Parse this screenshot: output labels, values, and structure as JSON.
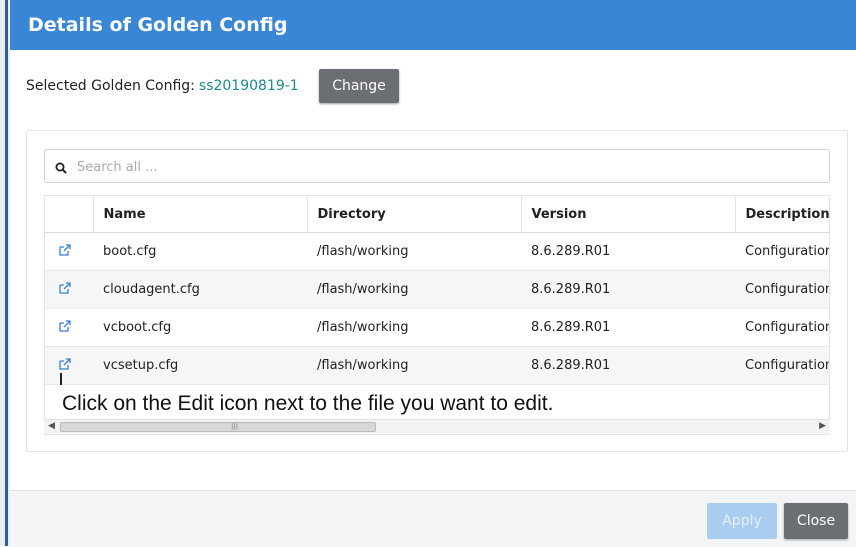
{
  "dialog": {
    "title": "Details of Golden Config",
    "selected_label": "Selected Golden Config:",
    "selected_value": "ss20190819-1",
    "change_label": "Change"
  },
  "search": {
    "placeholder": "Search all ..."
  },
  "table": {
    "columns": [
      "",
      "Name",
      "Directory",
      "Version",
      "Description"
    ],
    "rows": [
      {
        "name": "boot.cfg",
        "directory": "/flash/working",
        "version": "8.6.289.R01",
        "description": "Configuration"
      },
      {
        "name": "cloudagent.cfg",
        "directory": "/flash/working",
        "version": "8.6.289.R01",
        "description": "Configuration"
      },
      {
        "name": "vcboot.cfg",
        "directory": "/flash/working",
        "version": "8.6.289.R01",
        "description": "Configuration"
      },
      {
        "name": "vcsetup.cfg",
        "directory": "/flash/working",
        "version": "8.6.289.R01",
        "description": "Configuration"
      }
    ]
  },
  "caption": "Click on the Edit icon next to the file you want to edit.",
  "footer": {
    "apply_label": "Apply",
    "close_label": "Close"
  },
  "colors": {
    "title_bar": "#3a86d6",
    "link": "#1d8a8f",
    "button_dark": "#6b6f74",
    "button_disabled": "#a9cdee",
    "edit_icon": "#3b7fd0"
  },
  "icons": {
    "search": "search-icon",
    "edit": "edit-icon"
  }
}
